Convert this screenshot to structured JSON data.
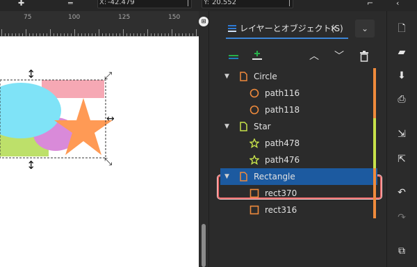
{
  "toolbar": {
    "x_label": "X:",
    "x_value": "-42.479",
    "y_label": "Y:",
    "y_value": "20.552"
  },
  "ruler": {
    "labels": [
      "75",
      "100",
      "125",
      "150"
    ]
  },
  "canvas": {
    "shape_colors": {
      "rectangle": "#f6a8b4",
      "circle_large": "#7fe3f7",
      "circle_small": "#d98ad9",
      "green_shape": "#bde06a",
      "star": "#ff9a55"
    }
  },
  "panel": {
    "tab_title": "レイヤーとオブジェクト(S)",
    "tab_close": "✕",
    "tree": [
      {
        "label": "Circle",
        "level": 0,
        "type": "group",
        "color": "#ef8a3c"
      },
      {
        "label": "path116",
        "level": 1,
        "type": "circle",
        "color": "#ef8a3c"
      },
      {
        "label": "path118",
        "level": 1,
        "type": "circle",
        "color": "#ef8a3c"
      },
      {
        "label": "Star",
        "level": 0,
        "type": "group",
        "color": "#c7e24a"
      },
      {
        "label": "path478",
        "level": 1,
        "type": "star",
        "color": "#c7e24a"
      },
      {
        "label": "path476",
        "level": 1,
        "type": "star",
        "color": "#c7e24a"
      },
      {
        "label": "Rectangle",
        "level": 0,
        "type": "group",
        "color": "#ef8a3c",
        "selected": true
      },
      {
        "label": "rect370",
        "level": 1,
        "type": "rect",
        "color": "#ef8a3c"
      },
      {
        "label": "rect316",
        "level": 1,
        "type": "rect",
        "color": "#ef8a3c"
      }
    ]
  },
  "colors": {
    "selection": "#1c5aa0",
    "accent": "#3d86d8",
    "highlight_outline": "#ef6c6c"
  }
}
